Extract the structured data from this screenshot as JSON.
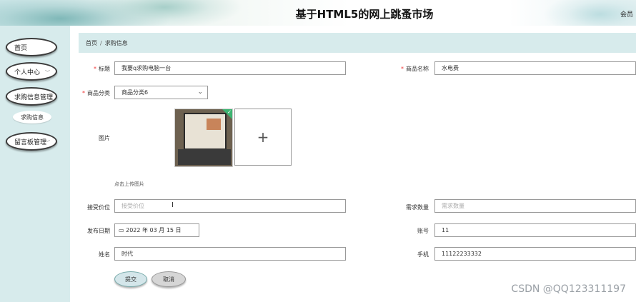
{
  "header": {
    "title": "基于HTML5的网上跳蚤市场",
    "member_label": "会员"
  },
  "sidebar": {
    "items": [
      {
        "label": "首页"
      },
      {
        "label": "个人中心",
        "chevron": "chevron-down-icon"
      },
      {
        "label": "求购信息管理"
      },
      {
        "label": "求购信息"
      },
      {
        "label": "留言板管理",
        "chevron": "chevron-down-icon"
      }
    ]
  },
  "breadcrumb": {
    "home": "首页",
    "separator": "/",
    "current": "求购信息"
  },
  "form": {
    "title": {
      "label": "标题",
      "required": "*",
      "value": "我要q求购电脑一台"
    },
    "product_name": {
      "label": "商品名称",
      "required": "*",
      "value": "水电费"
    },
    "category": {
      "label": "商品分类",
      "required": "*",
      "value": "商品分类6"
    },
    "image": {
      "label": "图片",
      "add_icon": "+",
      "hint": "点击上传图片"
    },
    "price": {
      "label": "接受价位",
      "placeholder": "接受价位"
    },
    "quantity": {
      "label": "需求数量",
      "placeholder": "需求数量"
    },
    "date": {
      "label": "发布日期",
      "value": "2022 年 03 月 15 日"
    },
    "account": {
      "label": "账号",
      "value": "11"
    },
    "name": {
      "label": "姓名",
      "value": "时代"
    },
    "phone": {
      "label": "手机",
      "value": "11122233332"
    }
  },
  "buttons": {
    "submit": "提交",
    "cancel": "取消"
  },
  "watermark": "CSDN @QQ123311197",
  "colors": {
    "sidebar_bg": "#d7ebec",
    "breadcrumb_bg": "#d7ebec",
    "required": "#ee3333",
    "submit_bg": "#d4e6ea",
    "cancel_bg": "#d6d6d6"
  }
}
